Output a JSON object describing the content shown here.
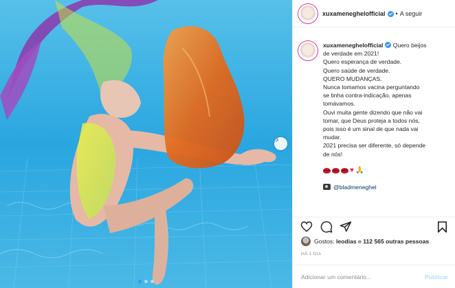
{
  "post": {
    "username": "xuxameneghelofficial",
    "separator": "•",
    "follow_label": "A seguir",
    "caption_lines": [
      "Quero beijos",
      "de verdade em 2021!",
      "Quero esperança de verdade.",
      "Quero saúde de verdade.",
      "QUERO MUDANÇAS.",
      "Nunca tomamos vacina perguntando",
      "se tinha contra-indicação, apenas",
      "tomávamos.",
      "Ouvi muita gente dizendo que não vai",
      "tomar, que Deus proteja a todos nós,",
      "pois isso é um sinal de que nada vai",
      "mudar.",
      "2021 precisa ser diferente, só depende",
      "de nós!"
    ],
    "emoji_icons": [
      "lips-icon",
      "lips-icon",
      "lips-icon",
      "heart-icon",
      "praying-hands-icon"
    ],
    "mention": "@bladmeneghel",
    "likes_prefix": "Gostos: ",
    "likes_user": "leodias",
    "likes_conjunction": " e ",
    "likes_count": "112 565 outras pessoas",
    "time_ago": "HÁ 1 DIA",
    "comment_placeholder": "Adicionar um comentário...",
    "publish_label": "Publicar"
  },
  "carousel": {
    "total": 3,
    "active": 0
  },
  "colors": {
    "accent": "#3897f0",
    "link": "#00376b",
    "muted": "#8e8e8e",
    "publish_disabled": "#b2dffc"
  }
}
